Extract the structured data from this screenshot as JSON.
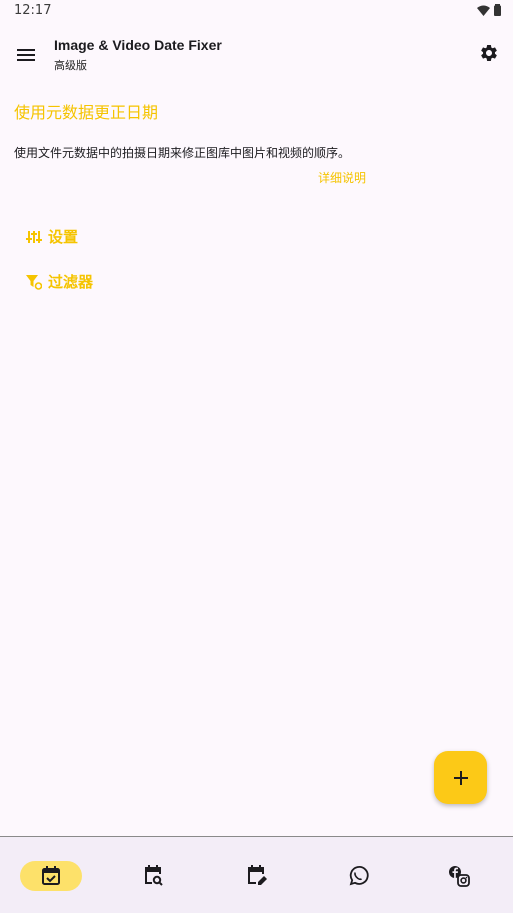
{
  "status_bar": {
    "time": "12:17"
  },
  "app_bar": {
    "title": "Image & Video Date Fixer",
    "subtitle": "高级版"
  },
  "main": {
    "section_title": "使用元数据更正日期",
    "description": "使用文件元数据中的拍摄日期来修正图库中图片和视频的顺序。",
    "details_link": "详细说明",
    "settings_label": "设置",
    "filter_label": "过滤器"
  },
  "fab": {
    "label": "+"
  },
  "bottom_nav": {
    "items": [
      {
        "icon": "calendar-check-icon",
        "active": true
      },
      {
        "icon": "calendar-search-icon",
        "active": false
      },
      {
        "icon": "calendar-edit-icon",
        "active": false
      },
      {
        "icon": "whatsapp-icon",
        "active": false
      },
      {
        "icon": "facebook-instagram-icon",
        "active": false
      }
    ]
  },
  "colors": {
    "accent": "#f5c400",
    "fab": "#fcc917",
    "nav_active": "#fde16a",
    "nav_bg": "#f3edf7",
    "background": "#fdf8fd"
  }
}
